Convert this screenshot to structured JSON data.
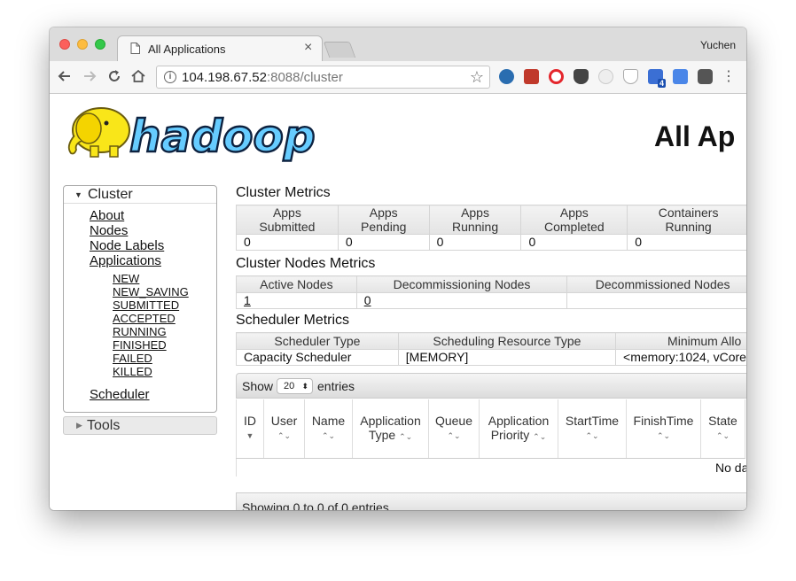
{
  "browser": {
    "tab_title": "All Applications",
    "tab_close": "×",
    "profile_name": "Yuchen",
    "url_host": "104.198.67.52",
    "url_rest": ":8088/cluster",
    "extension_badge": "4",
    "icons": [
      "back-icon",
      "forward-icon",
      "reload-icon",
      "home-icon",
      "info-icon",
      "star-icon",
      "menu-icon"
    ]
  },
  "page": {
    "logo_text": "hadoop",
    "heading": "All Ap"
  },
  "sidebar": {
    "cluster_label": "Cluster",
    "links": [
      {
        "label": "About"
      },
      {
        "label": "Nodes"
      },
      {
        "label": "Node Labels"
      },
      {
        "label": "Applications"
      }
    ],
    "states": [
      "NEW",
      "NEW_SAVING",
      "SUBMITTED",
      "ACCEPTED",
      "RUNNING",
      "FINISHED",
      "FAILED",
      "KILLED"
    ],
    "scheduler_label": "Scheduler",
    "tools_label": "Tools"
  },
  "cluster_metrics": {
    "title": "Cluster Metrics",
    "headers": [
      [
        "Apps",
        "Submitted"
      ],
      [
        "Apps",
        "Pending"
      ],
      [
        "Apps",
        "Running"
      ],
      [
        "Apps",
        "Completed"
      ],
      [
        "Containers",
        "Running"
      ]
    ],
    "values": [
      "0",
      "0",
      "0",
      "0",
      "0"
    ]
  },
  "nodes_metrics": {
    "title": "Cluster Nodes Metrics",
    "headers": [
      "Active Nodes",
      "Decommissioning Nodes",
      "Decommissioned Nodes"
    ],
    "values": [
      "1",
      "0",
      ""
    ]
  },
  "scheduler_metrics": {
    "title": "Scheduler Metrics",
    "headers": [
      "Scheduler Type",
      "Scheduling Resource Type",
      "Minimum Allo"
    ],
    "values": [
      "Capacity Scheduler",
      "[MEMORY]",
      "<memory:1024, vCore"
    ]
  },
  "applications": {
    "show_label": "Show",
    "page_size": "20",
    "entries_label": "entries",
    "columns": [
      [
        "ID",
        ""
      ],
      [
        "User",
        ""
      ],
      [
        "Name",
        ""
      ],
      [
        "Application",
        "Type"
      ],
      [
        "Queue",
        ""
      ],
      [
        "Application",
        "Priority"
      ],
      [
        "StartTime",
        ""
      ],
      [
        "FinishTime",
        ""
      ],
      [
        "State",
        ""
      ]
    ],
    "empty_text": "No da",
    "footer": "Showing 0 to 0 of 0 entries"
  }
}
